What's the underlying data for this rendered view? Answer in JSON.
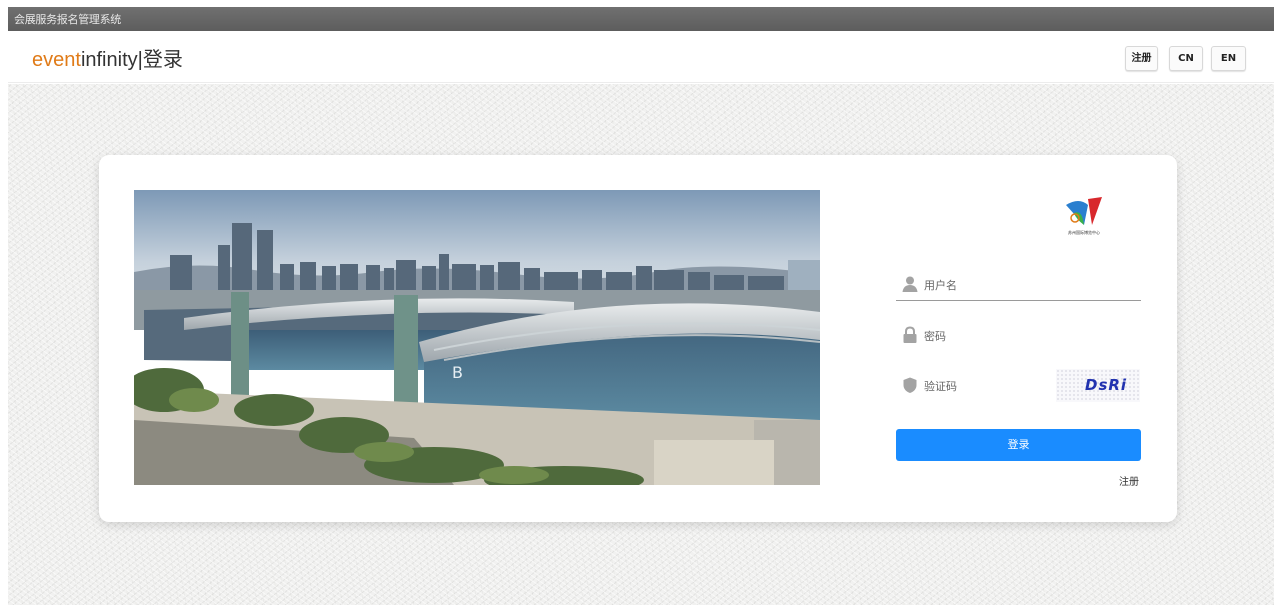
{
  "window": {
    "title_bar_text": "会展服务报名管理系统"
  },
  "header": {
    "brand_part1": "event",
    "brand_part2": "infinity",
    "brand_separator": "|",
    "brand_page": "登录",
    "register_button": "注册",
    "cn_button": "CN",
    "en_button": "EN"
  },
  "login": {
    "username_placeholder": "用户名",
    "password_placeholder": "密码",
    "captcha_placeholder": "验证码",
    "captcha_text": "DsRi",
    "submit_label": "登录",
    "register_link": "注册",
    "logo_caption": "苏州国际博览中心"
  },
  "colors": {
    "brand_accent": "#e07b18",
    "primary_button": "#1a8cff",
    "captcha_text": "#2233b0"
  },
  "icons": {
    "username": "user-icon",
    "password": "lock-icon",
    "captcha": "shield-icon"
  }
}
